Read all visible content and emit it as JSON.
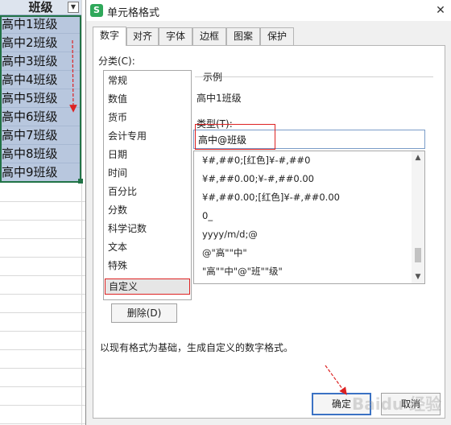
{
  "sheet": {
    "column_header": "班级",
    "cells": [
      "高中1班级",
      "高中2班级",
      "高中3班级",
      "高中4班级",
      "高中5班级",
      "高中6班级",
      "高中7班级",
      "高中8班级",
      "高中9班级"
    ]
  },
  "dialog": {
    "title": "单元格格式",
    "app_icon_letter": "S",
    "close_glyph": "✕",
    "tabs": [
      "数字",
      "对齐",
      "字体",
      "边框",
      "图案",
      "保护"
    ],
    "category_label": "分类(C):",
    "categories": [
      "常规",
      "数值",
      "货币",
      "会计专用",
      "日期",
      "时间",
      "百分比",
      "分数",
      "科学记数",
      "文本",
      "特殊",
      "自定义"
    ],
    "selected_category": "自定义",
    "sample_label": "示例",
    "sample_value": "高中1班级",
    "type_label": "类型(T):",
    "type_value": "高中@班级",
    "format_list": [
      "¥#,##0;[红色]¥-#,##0",
      "¥#,##0.00;¥-#,##0.00",
      "¥#,##0.00;[红色]¥-#,##0.00",
      "0_",
      "yyyy/m/d;@",
      "@\"高\"\"中\"",
      "\"高\"\"中\"@\"班\"\"级\""
    ],
    "delete_label": "删除(D)",
    "description": "以现有格式为基础，生成自定义的数字格式。",
    "ok_label": "确定",
    "cancel_label": "取消",
    "watermark": "Baidu 经验"
  },
  "colors": {
    "selection_fill": "#b8c7de",
    "header_fill": "#dde4ee",
    "annotation_red": "#dd2222",
    "ok_border": "#3b72c4"
  }
}
